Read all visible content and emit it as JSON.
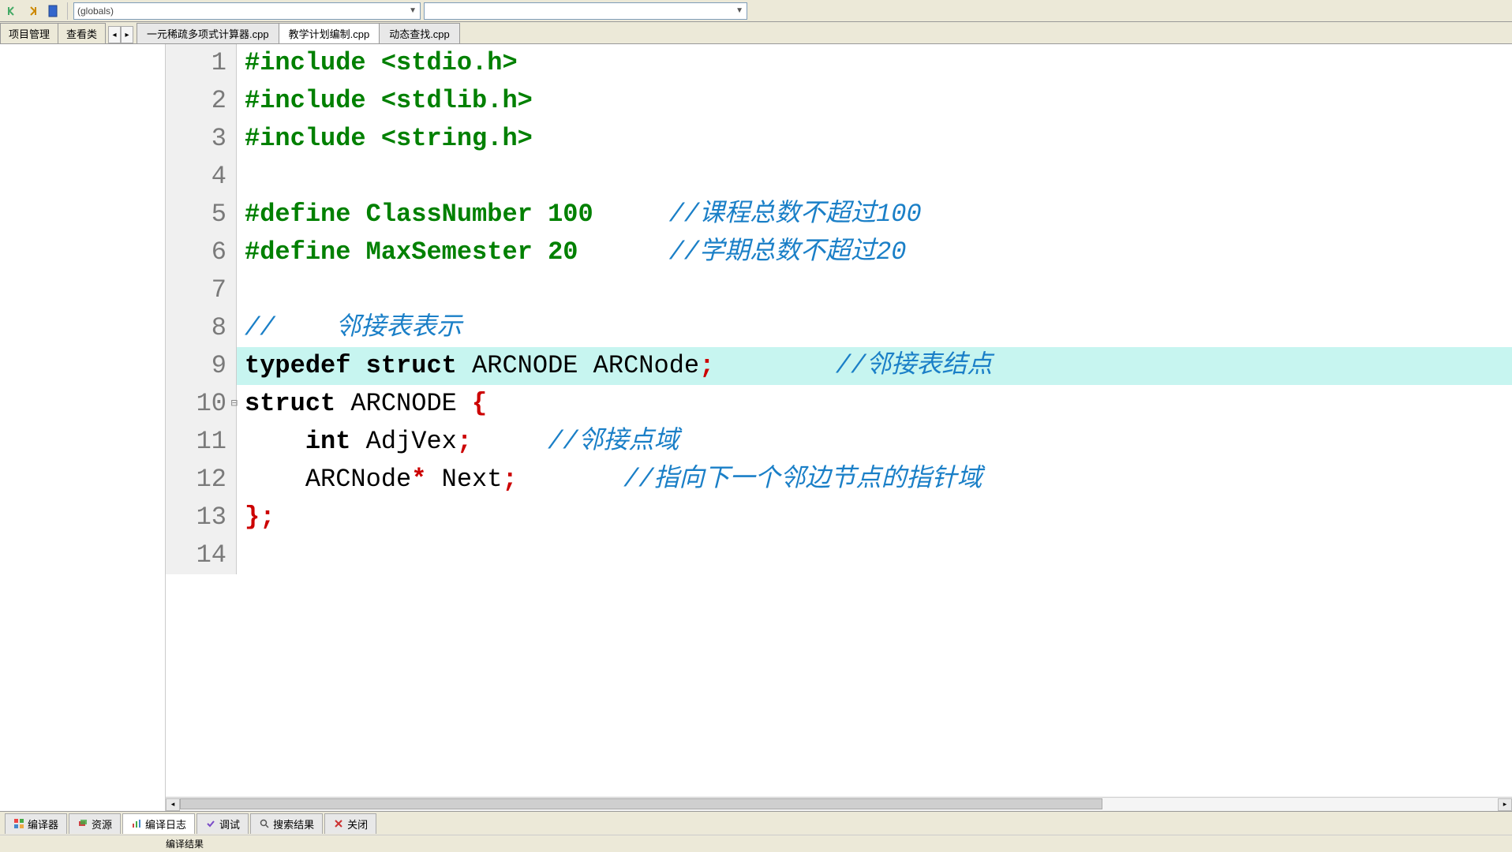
{
  "toolbar": {
    "globals_label": "(globals)"
  },
  "side_tabs": {
    "project": "项目管理",
    "view": "查看类"
  },
  "file_tabs": [
    {
      "label": "一元稀疏多项式计算器.cpp",
      "active": false
    },
    {
      "label": "教学计划编制.cpp",
      "active": true
    },
    {
      "label": "动态查找.cpp",
      "active": false
    }
  ],
  "code": {
    "lines": [
      {
        "n": 1,
        "tokens": [
          [
            "preproc",
            "#include "
          ],
          [
            "preproc",
            "<stdio.h>"
          ]
        ]
      },
      {
        "n": 2,
        "tokens": [
          [
            "preproc",
            "#include "
          ],
          [
            "preproc",
            "<stdlib.h>"
          ]
        ]
      },
      {
        "n": 3,
        "tokens": [
          [
            "preproc",
            "#include "
          ],
          [
            "preproc",
            "<string.h>"
          ]
        ]
      },
      {
        "n": 4,
        "tokens": []
      },
      {
        "n": 5,
        "tokens": [
          [
            "preproc",
            "#define ClassNumber 100"
          ],
          [
            "plain",
            "     "
          ],
          [
            "comment",
            "//课程总数不超过100"
          ]
        ]
      },
      {
        "n": 6,
        "tokens": [
          [
            "preproc",
            "#define MaxSemester 20"
          ],
          [
            "plain",
            "      "
          ],
          [
            "comment",
            "//学期总数不超过20"
          ]
        ]
      },
      {
        "n": 7,
        "tokens": []
      },
      {
        "n": 8,
        "tokens": [
          [
            "comment",
            "//    邻接表表示"
          ]
        ]
      },
      {
        "n": 9,
        "highlight": true,
        "tokens": [
          [
            "keyword",
            "typedef "
          ],
          [
            "keyword",
            "struct "
          ],
          [
            "ident",
            "ARCNODE ARCNode"
          ],
          [
            "punct-red",
            ";"
          ],
          [
            "plain",
            "        "
          ],
          [
            "comment",
            "//邻接表结点"
          ]
        ]
      },
      {
        "n": 10,
        "fold": "⊟",
        "tokens": [
          [
            "keyword",
            "struct "
          ],
          [
            "ident",
            "ARCNODE "
          ],
          [
            "punct-red",
            "{"
          ]
        ]
      },
      {
        "n": 11,
        "foldline": true,
        "tokens": [
          [
            "plain",
            "    "
          ],
          [
            "keyword",
            "int "
          ],
          [
            "ident",
            "AdjVex"
          ],
          [
            "punct-red",
            ";"
          ],
          [
            "plain",
            "     "
          ],
          [
            "comment",
            "//邻接点域"
          ]
        ]
      },
      {
        "n": 12,
        "foldline": true,
        "tokens": [
          [
            "plain",
            "    "
          ],
          [
            "ident",
            "ARCNode"
          ],
          [
            "op",
            "* "
          ],
          [
            "ident",
            "Next"
          ],
          [
            "punct-red",
            ";"
          ],
          [
            "plain",
            "       "
          ],
          [
            "comment",
            "//指向下一个邻边节点的指针域"
          ]
        ]
      },
      {
        "n": 13,
        "foldline": true,
        "tokens": [
          [
            "punct-red",
            "};"
          ]
        ]
      },
      {
        "n": 14,
        "tokens": []
      }
    ]
  },
  "bottom_tabs": {
    "compiler": "编译器",
    "resources": "资源",
    "compile_log": "编译日志",
    "debug": "调试",
    "search_results": "搜索结果",
    "close": "关闭"
  },
  "status": {
    "text": "编译结果"
  }
}
